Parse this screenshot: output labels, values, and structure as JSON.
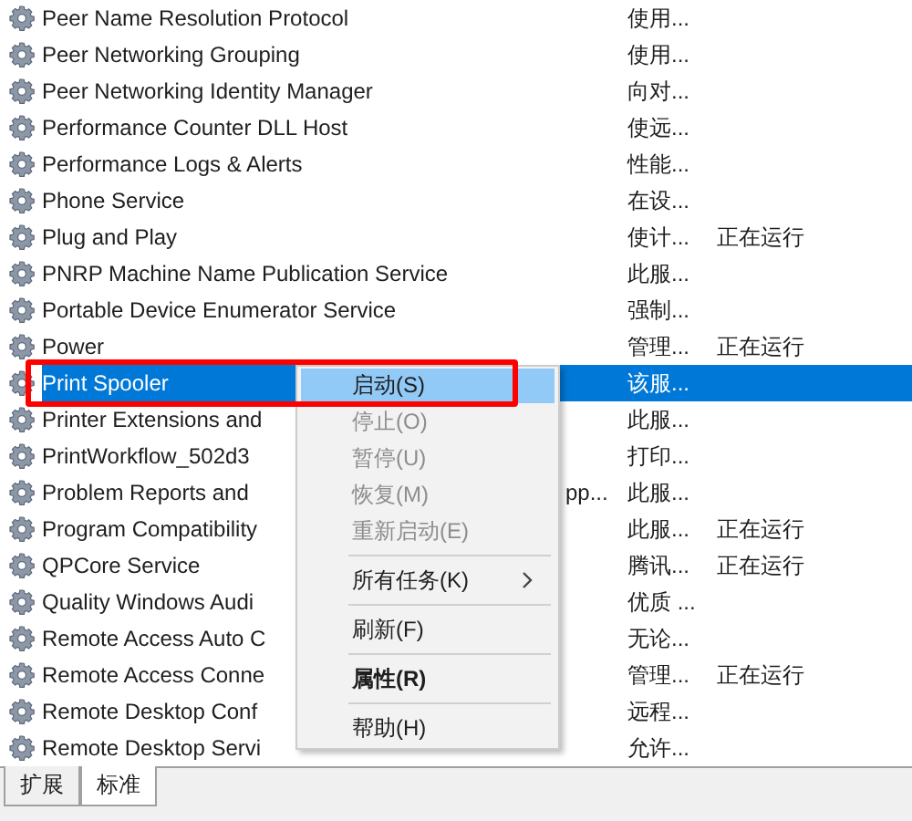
{
  "services": [
    {
      "name": "Peer Name Resolution Protocol",
      "description": "使用...",
      "selected": false
    },
    {
      "name": "Peer Networking Grouping",
      "description": "使用...",
      "selected": false
    },
    {
      "name": "Peer Networking Identity Manager",
      "description": "向对...",
      "selected": false
    },
    {
      "name": "Performance Counter DLL Host",
      "description": "使远...",
      "selected": false
    },
    {
      "name": "Performance Logs & Alerts",
      "description": "性能...",
      "selected": false
    },
    {
      "name": "Phone Service",
      "description": "在设...",
      "selected": false
    },
    {
      "name": "Plug and Play",
      "description": "使计...",
      "status": "正在运行",
      "selected": false
    },
    {
      "name": "PNRP Machine Name Publication Service",
      "description": "此服...",
      "selected": false
    },
    {
      "name": "Portable Device Enumerator Service",
      "description": "强制...",
      "selected": false
    },
    {
      "name": "Power",
      "description": "管理...",
      "status": "正在运行",
      "selected": false
    },
    {
      "name": "Print Spooler",
      "description": "该服...",
      "selected": true
    },
    {
      "name": "Printer Extensions and",
      "description": "此服...",
      "selected": false
    },
    {
      "name": "PrintWorkflow_502d3",
      "description": "打印...",
      "selected": false
    },
    {
      "name": "Problem Reports and",
      "name_tail": "pp...",
      "description": "此服...",
      "selected": false
    },
    {
      "name": "Program Compatibility",
      "description": "此服...",
      "status": "正在运行",
      "selected": false
    },
    {
      "name": "QPCore Service",
      "description": "腾讯...",
      "status": "正在运行",
      "selected": false
    },
    {
      "name": "Quality Windows Audi",
      "description": "优质 ...",
      "selected": false
    },
    {
      "name": "Remote Access Auto C",
      "description": "无论...",
      "selected": false
    },
    {
      "name": "Remote Access Conne",
      "description": "管理...",
      "status": "正在运行",
      "selected": false
    },
    {
      "name": "Remote Desktop Conf",
      "description": "远程...",
      "selected": false
    },
    {
      "name": "Remote Desktop Servi",
      "description": "允许...",
      "selected": false
    }
  ],
  "context_menu": {
    "items": [
      {
        "kind": "item",
        "label": "启动(S)",
        "selected": true,
        "disabled": false,
        "bold": false,
        "submenu": false
      },
      {
        "kind": "item",
        "label": "停止(O)",
        "selected": false,
        "disabled": true,
        "bold": false,
        "submenu": false
      },
      {
        "kind": "item",
        "label": "暂停(U)",
        "selected": false,
        "disabled": true,
        "bold": false,
        "submenu": false
      },
      {
        "kind": "item",
        "label": "恢复(M)",
        "selected": false,
        "disabled": true,
        "bold": false,
        "submenu": false
      },
      {
        "kind": "item",
        "label": "重新启动(E)",
        "selected": false,
        "disabled": true,
        "bold": false,
        "submenu": false
      },
      {
        "kind": "separator"
      },
      {
        "kind": "item",
        "label": "所有任务(K)",
        "selected": false,
        "disabled": false,
        "bold": false,
        "submenu": true
      },
      {
        "kind": "separator"
      },
      {
        "kind": "item",
        "label": "刷新(F)",
        "selected": false,
        "disabled": false,
        "bold": false,
        "submenu": false
      },
      {
        "kind": "separator"
      },
      {
        "kind": "item",
        "label": "属性(R)",
        "selected": false,
        "disabled": false,
        "bold": true,
        "submenu": false
      },
      {
        "kind": "separator"
      },
      {
        "kind": "item",
        "label": "帮助(H)",
        "selected": false,
        "disabled": false,
        "bold": false,
        "submenu": false
      }
    ]
  },
  "tabs": [
    {
      "label": "扩展",
      "selected": false
    },
    {
      "label": "标准",
      "selected": true
    }
  ]
}
